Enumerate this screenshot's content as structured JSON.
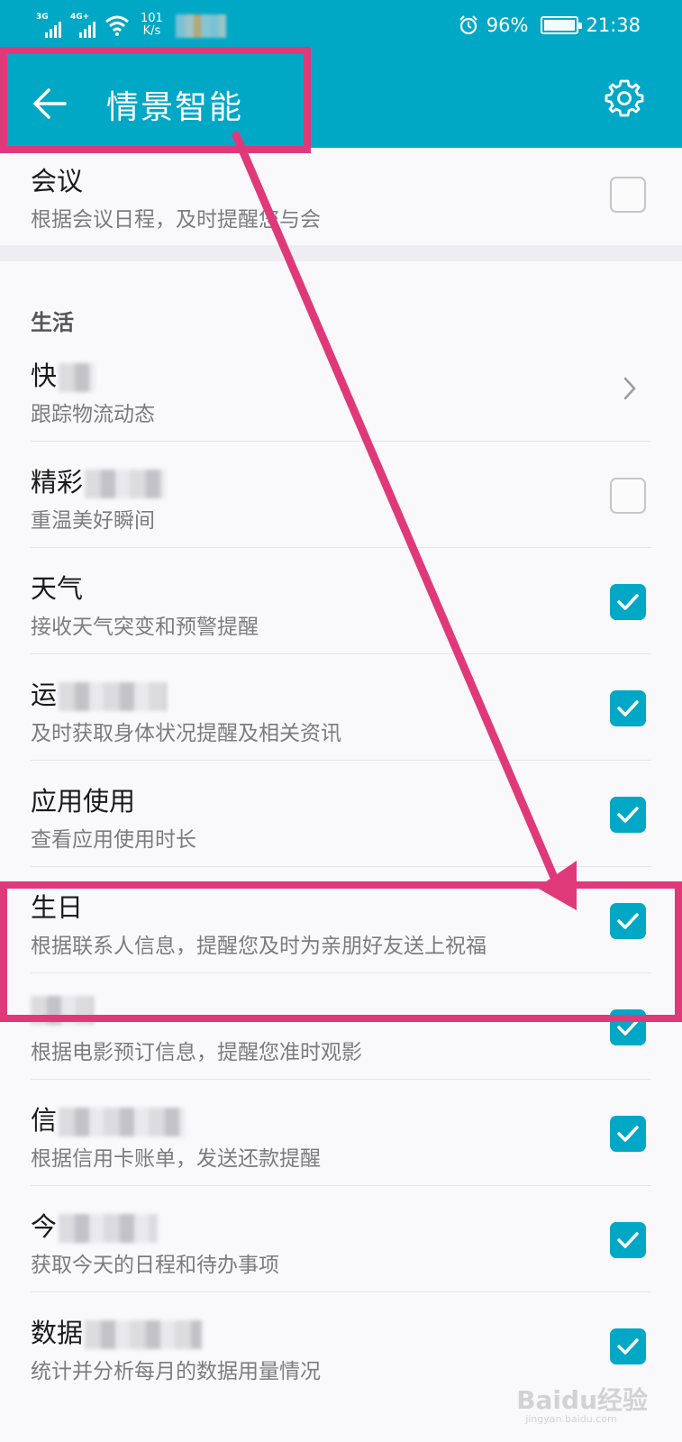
{
  "status_bar": {
    "signal1": "3G",
    "signal2": "4G+",
    "net_speed_value": "101",
    "net_speed_unit": "K/s",
    "battery": "96%",
    "time": "21:38"
  },
  "header": {
    "title": "情景智能",
    "back_icon": "back-arrow-icon",
    "settings_icon": "gear-icon",
    "bg_color": "#00a8c6"
  },
  "items": [
    {
      "title": "会议",
      "subtitle": "根据会议日程，及时提醒您与会",
      "control": "checkbox",
      "checked": false
    },
    {
      "title": "快",
      "subtitle": "跟踪物流动态",
      "control": "chevron"
    },
    {
      "title": "精彩",
      "subtitle": "重温美好瞬间",
      "control": "checkbox",
      "checked": false
    },
    {
      "title": "天气",
      "subtitle": "接收天气突变和预警提醒",
      "control": "checkbox",
      "checked": true
    },
    {
      "title": "运",
      "subtitle": "及时获取身体状况提醒及相关资讯",
      "control": "checkbox",
      "checked": true
    },
    {
      "title": "应用使用",
      "subtitle": "查看应用使用时长",
      "control": "checkbox",
      "checked": true
    },
    {
      "title": "生日",
      "subtitle": "根据联系人信息，提醒您及时为亲朋好友送上祝福",
      "control": "checkbox",
      "checked": true
    },
    {
      "title": "电影",
      "subtitle": "根据电影预订信息，提醒您准时观影",
      "control": "checkbox",
      "checked": true
    },
    {
      "title": "信",
      "subtitle": "根据信用卡账单，发送还款提醒",
      "control": "checkbox",
      "checked": true
    },
    {
      "title": "今",
      "subtitle": "获取今天的日程和待办事项",
      "control": "checkbox",
      "checked": true
    },
    {
      "title": "数据",
      "subtitle": "统计并分析每月的数据用量情况",
      "control": "checkbox",
      "checked": true
    }
  ],
  "section": {
    "life": "生活"
  },
  "watermark": {
    "logo": "Baidu经验",
    "url": "jingyan.baidu.com"
  },
  "annotation_color": "#e0397a"
}
